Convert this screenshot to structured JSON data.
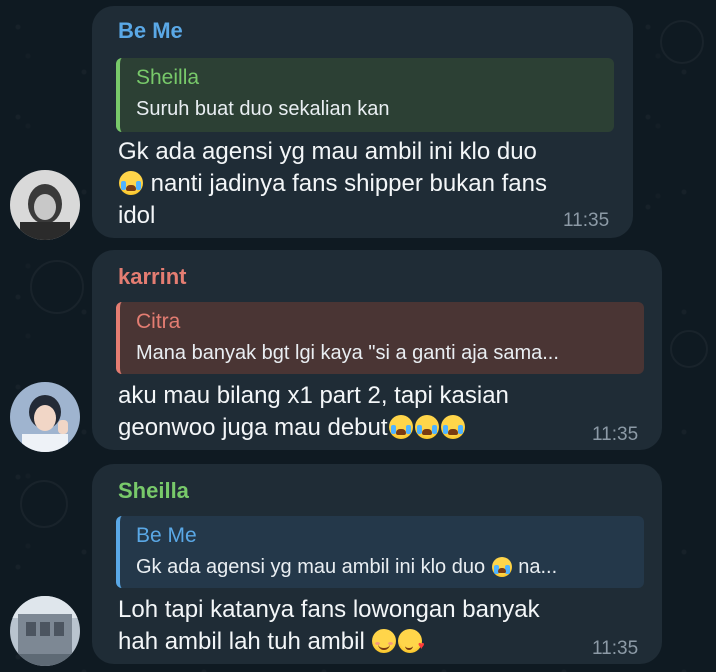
{
  "colors": {
    "background": "#0f1a22",
    "bubble": "#1f2c36",
    "sender_be_me": "#5aa8e6",
    "sender_karrint": "#e47d72",
    "sender_sheilla": "#78c96a",
    "time": "#8c9aa6"
  },
  "messages": [
    {
      "sender": "Be Me",
      "reply_to": {
        "name": "Sheilla",
        "text": "Suruh buat duo sekalian kan"
      },
      "lines": [
        "Gk ada agensi yg mau ambil ini klo duo",
        "nanti jadinya fans shipper bukan fans",
        "idol"
      ],
      "emoji": [
        "loudly-crying-face-icon"
      ],
      "time": "11:35"
    },
    {
      "sender": "karrint",
      "reply_to": {
        "name": "Citra",
        "text": "Mana banyak bgt lgi kaya \"si a ganti aja sama..."
      },
      "lines": [
        "aku mau bilang x1 part 2, tapi kasian",
        "geonwoo juga mau debut"
      ],
      "emoji": [
        "loudly-crying-face-icon",
        "loudly-crying-face-icon",
        "loudly-crying-face-icon"
      ],
      "time": "11:35"
    },
    {
      "sender": "Sheilla",
      "reply_to": {
        "name": "Be Me",
        "text_prefix": "Gk ada agensi yg mau ambil ini klo duo",
        "text_suffix": "na..."
      },
      "lines": [
        "Loh tapi katanya fans lowongan banyak",
        "hah ambil lah tuh ambil"
      ],
      "emoji": [
        "smiling-face-icon",
        "face-blowing-kiss-icon"
      ],
      "time": "11:35"
    }
  ]
}
